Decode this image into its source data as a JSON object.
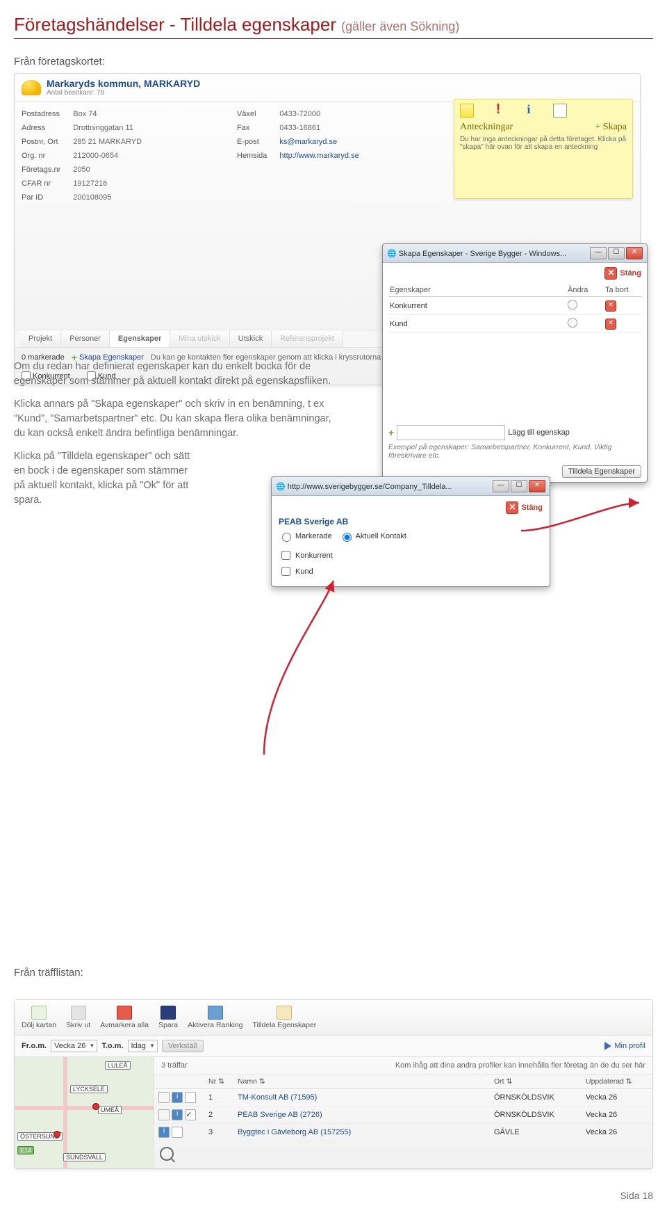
{
  "title_main": "Företagshändelser - Tilldela egenskaper",
  "title_sub": "(gäller även Sökning)",
  "intro_label": "Från företagskortet:",
  "company": {
    "name": "Markaryds kommun, MARKARYD",
    "visits": "Antal besökare: 78",
    "left": [
      {
        "k": "Postadress",
        "v": "Box 74"
      },
      {
        "k": "Adress",
        "v": "Drottninggatan 11"
      },
      {
        "k": "Postnr, Ort",
        "v": "285 21 MARKARYD"
      },
      {
        "k": "Org. nr",
        "v": "212000-0654"
      },
      {
        "k": "Företags.nr",
        "v": "2050"
      },
      {
        "k": "CFAR nr",
        "v": "19127216"
      },
      {
        "k": "Par ID",
        "v": "200108095"
      }
    ],
    "right": [
      {
        "k": "Växel",
        "v": "0433-72000"
      },
      {
        "k": "Fax",
        "v": "0433-16861"
      },
      {
        "k": "E-post",
        "v": "ks@markaryd.se",
        "link": true
      },
      {
        "k": "Hemsida",
        "v": "http://www.markaryd.se",
        "link": true
      }
    ]
  },
  "sticky": {
    "title": "Anteckningar",
    "create": "Skapa",
    "body": "Du har inga anteckningar på detta företaget. Klicka på \"skapa\" här ovan för att skapa en anteckning"
  },
  "tabs": [
    "Projekt",
    "Personer",
    "Egenskaper",
    "Mina utskick",
    "Utskick",
    "Referensprojekt"
  ],
  "egens_row": {
    "count": "0 markerade",
    "skapa": "Skapa Egenskaper",
    "hint": "Du kan ge kontakten fler egenskaper genom att klicka i kryssrutorna"
  },
  "checkboxes": [
    "Konkurrent",
    "Kund"
  ],
  "body1": "Om du redan har definierat egenskaper kan du enkelt bocka för de egenskaper som stämmer på aktuell kontakt direkt på egenskapsfliken.",
  "body2": "Klicka annars på \"Skapa egenskaper\" och skriv in en benämning, t ex \"Kund\", \"Samarbetspartner\" etc. Du kan skapa flera olika benämningar, du kan också enkelt ändra befintliga benämningar.",
  "body3": "Klicka på \"Tilldela egenskaper\" och sätt en bock i de egenskaper som stämmer på aktuell kontakt, klicka på \"Ok\" för att spara.",
  "win_skapa": {
    "title": "Skapa Egenskaper - Sverige Bygger - Windows...",
    "stang": "Stäng",
    "cols": [
      "Egenskaper",
      "Ändra",
      "Ta bort"
    ],
    "rows": [
      "Konkurrent",
      "Kund"
    ],
    "lagg": "Lägg till egenskap",
    "exempel": "Exempel på egenskaper: Samarbetspartner, Konkurrent, Kund, Viktig föreskrivare etc.",
    "tilldela": "Tilldela Egenskaper"
  },
  "win_tilldela": {
    "url": "http://www.sverigebygger.se/Company_Tilldela...",
    "stang": "Stäng",
    "company": "PEAB Sverige AB",
    "radio1": "Markerade",
    "radio2": "Aktuell Kontakt",
    "chk": [
      "Konkurrent",
      "Kund"
    ]
  },
  "treff_label": "Från träfflistan:",
  "toolbar": [
    "Dölj kartan",
    "Skriv ut",
    "Avmarkera alla",
    "Spara",
    "Aktivera Ranking",
    "Tilldela Egenskaper"
  ],
  "daterow": {
    "from": "Fr.o.m.",
    "from_v": "Vecka 26",
    "to": "T.o.m.",
    "to_v": "Idag",
    "verk": "Verkställ",
    "profil": "Min profil"
  },
  "results": {
    "count": "3 träffar",
    "hint": "Kom ihåg att dina andra profiler kan innehålla fler företag än de du ser här",
    "cols": [
      "Nr",
      "Namn",
      "Ort",
      "Uppdaterad"
    ],
    "rows": [
      {
        "nr": "1",
        "namn": "TM-Konsult AB (71595)",
        "ort": "ÖRNSKÖLDSVIK",
        "upp": "Vecka 26",
        "chk": false
      },
      {
        "nr": "2",
        "namn": "PEAB Sverige AB (2726)",
        "ort": "ÖRNSKÖLDSVIK",
        "upp": "Vecka 26",
        "chk": true
      },
      {
        "nr": "3",
        "namn": "Byggtec i Gävleborg AB (157255)",
        "ort": "GÄVLE",
        "upp": "Vecka 26",
        "chk": false
      }
    ]
  },
  "map_labels": [
    "LULEÅ",
    "LYCKSELE",
    "UMEÅ",
    "ÖSTERSUND",
    "SUNDSVALL",
    "E14"
  ],
  "footer": "Sida 18"
}
